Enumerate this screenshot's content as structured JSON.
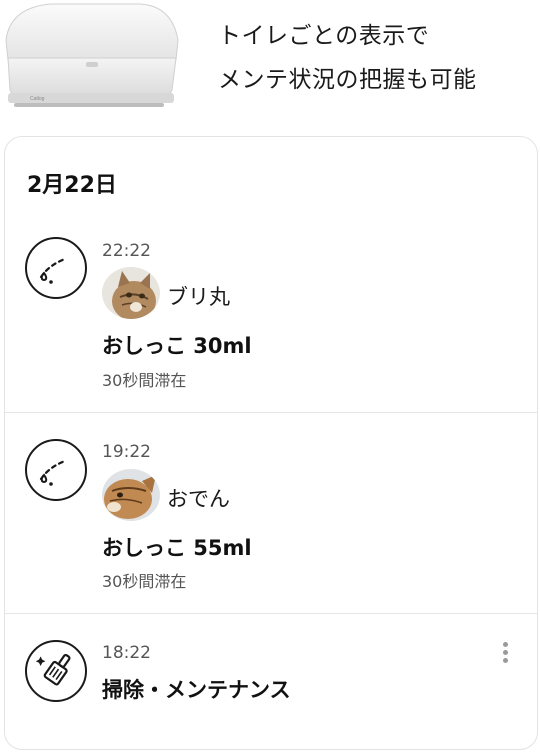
{
  "header": {
    "line1": "トイレごとの表示で",
    "line2": "メンテ状況の把握も可能",
    "device_label": "Catlog"
  },
  "timeline": {
    "date": "2月22日",
    "entries": [
      {
        "time": "22:22",
        "icon": "urine-icon",
        "cat_name": "ブリ丸",
        "event": "おしっこ 30ml",
        "duration": "30秒間滞在"
      },
      {
        "time": "19:22",
        "icon": "urine-icon",
        "cat_name": "おでん",
        "event": "おしっこ 55ml",
        "duration": "30秒間滞在"
      },
      {
        "time": "18:22",
        "icon": "cleaning-scoop-icon",
        "event": "掃除・メンテナンス"
      }
    ]
  },
  "colors": {
    "text": "#111111",
    "secondary_text": "#555555",
    "divider": "#e6e6e6",
    "card_border": "#e3e3e3"
  }
}
